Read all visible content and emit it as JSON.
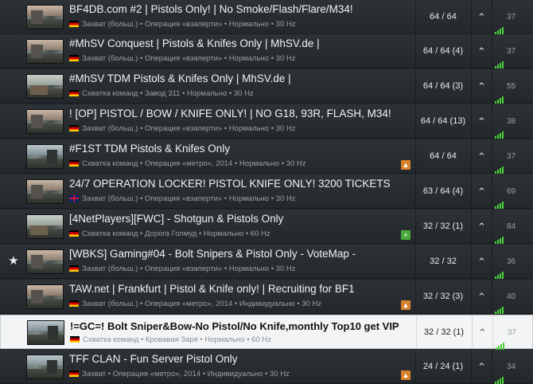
{
  "servers": [
    {
      "name": "BF4DB.com #2 | Pistols Only! | No Smoke/Flash/Flare/M34!",
      "flag": "de",
      "meta": "Захват (больш.) • Операция «взаперти» • Нормально • 30 Hz",
      "players": "64 / 64",
      "ping": "37",
      "favorite": false,
      "tag": "",
      "thumb": "t1"
    },
    {
      "name": "#MhSV Conquest | Pistols & Knifes Only | MhSV.de |",
      "flag": "de",
      "meta": "Захват (больш.) • Операция «взаперти» • Нормально • 30 Hz",
      "players": "64 / 64 (4)",
      "ping": "37",
      "favorite": false,
      "tag": "",
      "thumb": "t1"
    },
    {
      "name": "#MhSV TDM Pistols & Knifes Only | MhSV.de |",
      "flag": "de",
      "meta": "Схватка команд • Завод 311 • Нормально • 30 Hz",
      "players": "64 / 64 (3)",
      "ping": "55",
      "favorite": false,
      "tag": "",
      "thumb": "t3"
    },
    {
      "name": "! [OP] PISTOL / BOW / KNIFE ONLY! | NO G18, 93R, FLASH, M34!",
      "flag": "de",
      "meta": "Захват (больш.) • Операция «взаперти» • Нормально • 30 Hz",
      "players": "64 / 64 (13)",
      "ping": "38",
      "favorite": false,
      "tag": "",
      "thumb": "t1"
    },
    {
      "name": "#F1ST TDM Pistols & Knifes Only",
      "flag": "de",
      "meta": "Схватка команд • Операция «метро», 2014 • Нормально • 30 Hz",
      "players": "64 / 64",
      "ping": "37",
      "favorite": false,
      "tag": "orange",
      "thumb": "t2"
    },
    {
      "name": "24/7 OPERATION LOCKER! PISTOL KNIFE ONLY! 3200 TICKETS",
      "flag": "uk",
      "meta": "Захват (больш.) • Операция «взаперти» • Нормально • 30 Hz",
      "players": "63 / 64 (4)",
      "ping": "69",
      "favorite": false,
      "tag": "",
      "thumb": "t1"
    },
    {
      "name": "[4NetPlayers][FWC] - Shotgun & Pistols Only",
      "flag": "de",
      "meta": "Схватка команд • Дорога Голмуд • Нормально • 60 Hz",
      "players": "32 / 32 (1)",
      "ping": "84",
      "favorite": false,
      "tag": "green",
      "thumb": "t3"
    },
    {
      "name": "[WBKS] Gaming#04 - Bolt Snipers & Pistol Only - VoteMap -",
      "flag": "de",
      "meta": "Захват (больш.) • Операция «взаперти» • Нормально • 30 Hz",
      "players": "32 / 32",
      "ping": "36",
      "favorite": true,
      "tag": "",
      "thumb": "t1"
    },
    {
      "name": "TAW.net | Frankfurt | Pistol & Knife only! | Recruiting for BF1",
      "flag": "de",
      "meta": "Захват (больш.) • Операция «метро», 2014 • Индивидуально • 30 Hz",
      "players": "32 / 32 (3)",
      "ping": "40",
      "favorite": false,
      "tag": "orange",
      "thumb": "t1"
    },
    {
      "name": "!=GC=! Bolt Sniper&Bow-No Pistol/No Knife,monthly Top10 get VIP",
      "flag": "de",
      "meta": "Схватка команд • Кровавая Заря • Нормально • 60 Hz",
      "players": "32 / 32 (1)",
      "ping": "37",
      "favorite": false,
      "tag": "",
      "thumb": "t2",
      "selected": true
    },
    {
      "name": "TFF CLAN - Fun Server Pistol Only",
      "flag": "de",
      "meta": "Захват • Операция «метро», 2014 • Индивидуально • 30 Hz",
      "players": "24 / 24 (1)",
      "ping": "34",
      "favorite": false,
      "tag": "orange",
      "thumb": "t2"
    }
  ],
  "icons": {
    "favorite": "★",
    "join": "chevron-up-icon",
    "tag_orange": "fire-icon",
    "tag_green": "plus-icon"
  },
  "colors": {
    "signal": "#49d33a",
    "tag_orange": "#d7832c",
    "tag_green": "#4aa93a"
  }
}
